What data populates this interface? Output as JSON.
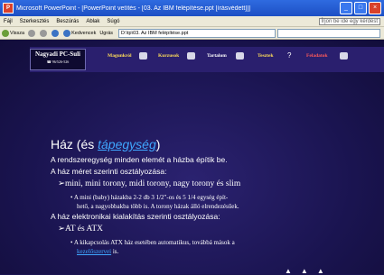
{
  "window": {
    "title": "Microsoft PowerPoint - [PowerPoint vetítés - [03. Az IBM felépítése.ppt [írásvédett]]]",
    "app_icon": "P"
  },
  "menu": {
    "items": [
      "Fájl",
      "Szerkesztés",
      "Beszúrás",
      "Ablak",
      "Súgó"
    ],
    "help_placeholder": "Írjon be ide egy kérdést"
  },
  "toolbar": {
    "back": "Vissza",
    "favorites": "Kedvencek",
    "go": "Ugrás",
    "address": "D:\\tp\\03. Az IBM felépítése.ppt"
  },
  "slide_nav": {
    "logo_line1": "Nagyadi PC-Suli",
    "logo_line2": "☎ 96/526-526",
    "buttons": [
      "Magunkról",
      "Kurzusok",
      "Tartalom",
      "Tesztek",
      "Feladatok"
    ],
    "active_color": "#ffde59",
    "feladatok_color": "#ff5a5a"
  },
  "slide": {
    "title_part1": "Ház (és ",
    "title_link": "tápegység",
    "title_part2": ")",
    "line1": "A rendszeregység minden elemét a házba építik be.",
    "line2": "A ház méret szerinti osztályozása:",
    "line3": "➢mini, mini torony, midi torony, nagy torony és slim",
    "line4a": "• A mini (baby) házakba 2-2 db 3 1/2\"-os és 5 1/4 egység épít-",
    "line4b": "hető, a nagyobbakba több is. A torony házak álló elrendezésűek.",
    "line5": "A ház elektronikai kialakítás szerinti osztályozása:",
    "line6": "➢AT és ATX",
    "line7a": "• A kikapcsolás ATX ház esetében automatikus, továbbá mások a",
    "line7_link": "kezelőszervei",
    "line7_rest": " is."
  }
}
